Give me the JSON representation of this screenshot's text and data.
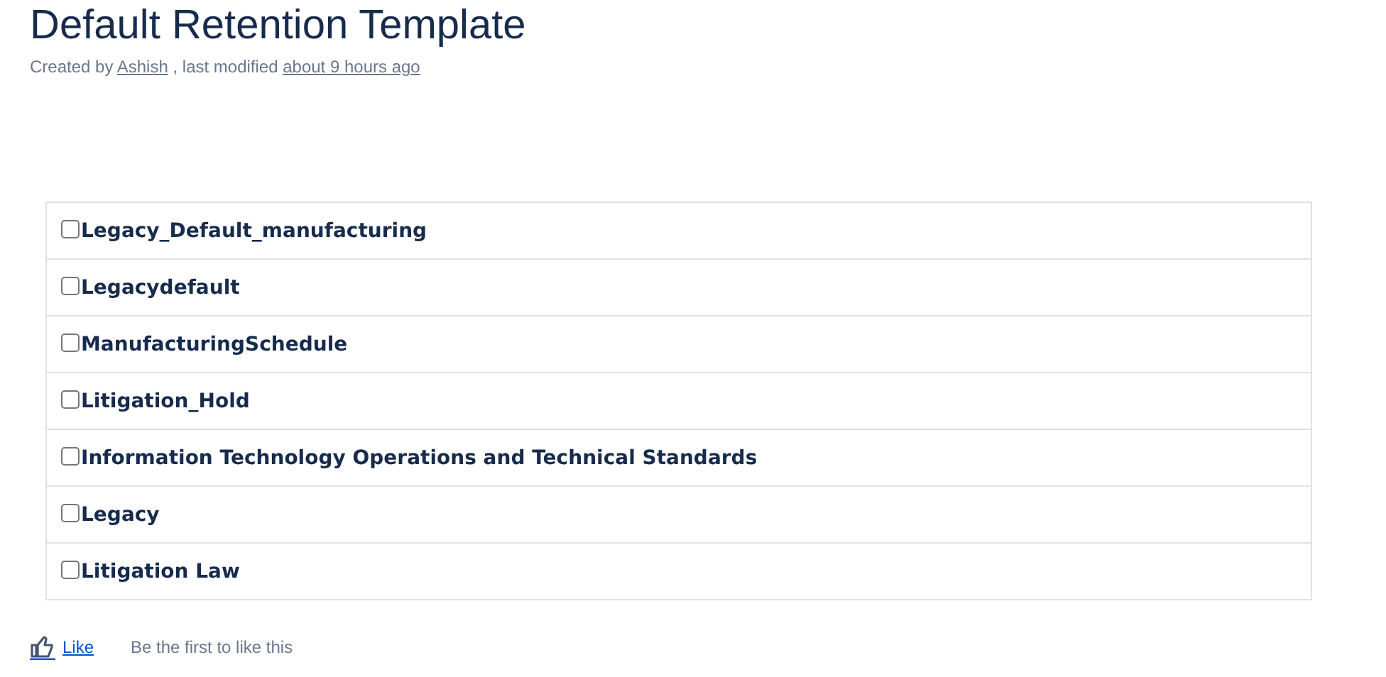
{
  "title": "Default Retention Template",
  "byline": {
    "prefix": "Created by",
    "author": "Ashish",
    "middle": ", last modified",
    "modified": "about 9 hours ago"
  },
  "items": [
    {
      "label": "Legacy_Default_manufacturing",
      "checked": false
    },
    {
      "label": "Legacydefault",
      "checked": false
    },
    {
      "label": "ManufacturingSchedule",
      "checked": false
    },
    {
      "label": "Litigation_Hold",
      "checked": false
    },
    {
      "label": "Information Technology Operations and Technical Standards",
      "checked": false
    },
    {
      "label": "Legacy",
      "checked": false
    },
    {
      "label": "Litigation Law",
      "checked": false
    }
  ],
  "like": {
    "label": "Like",
    "note": "Be the first to like this"
  }
}
